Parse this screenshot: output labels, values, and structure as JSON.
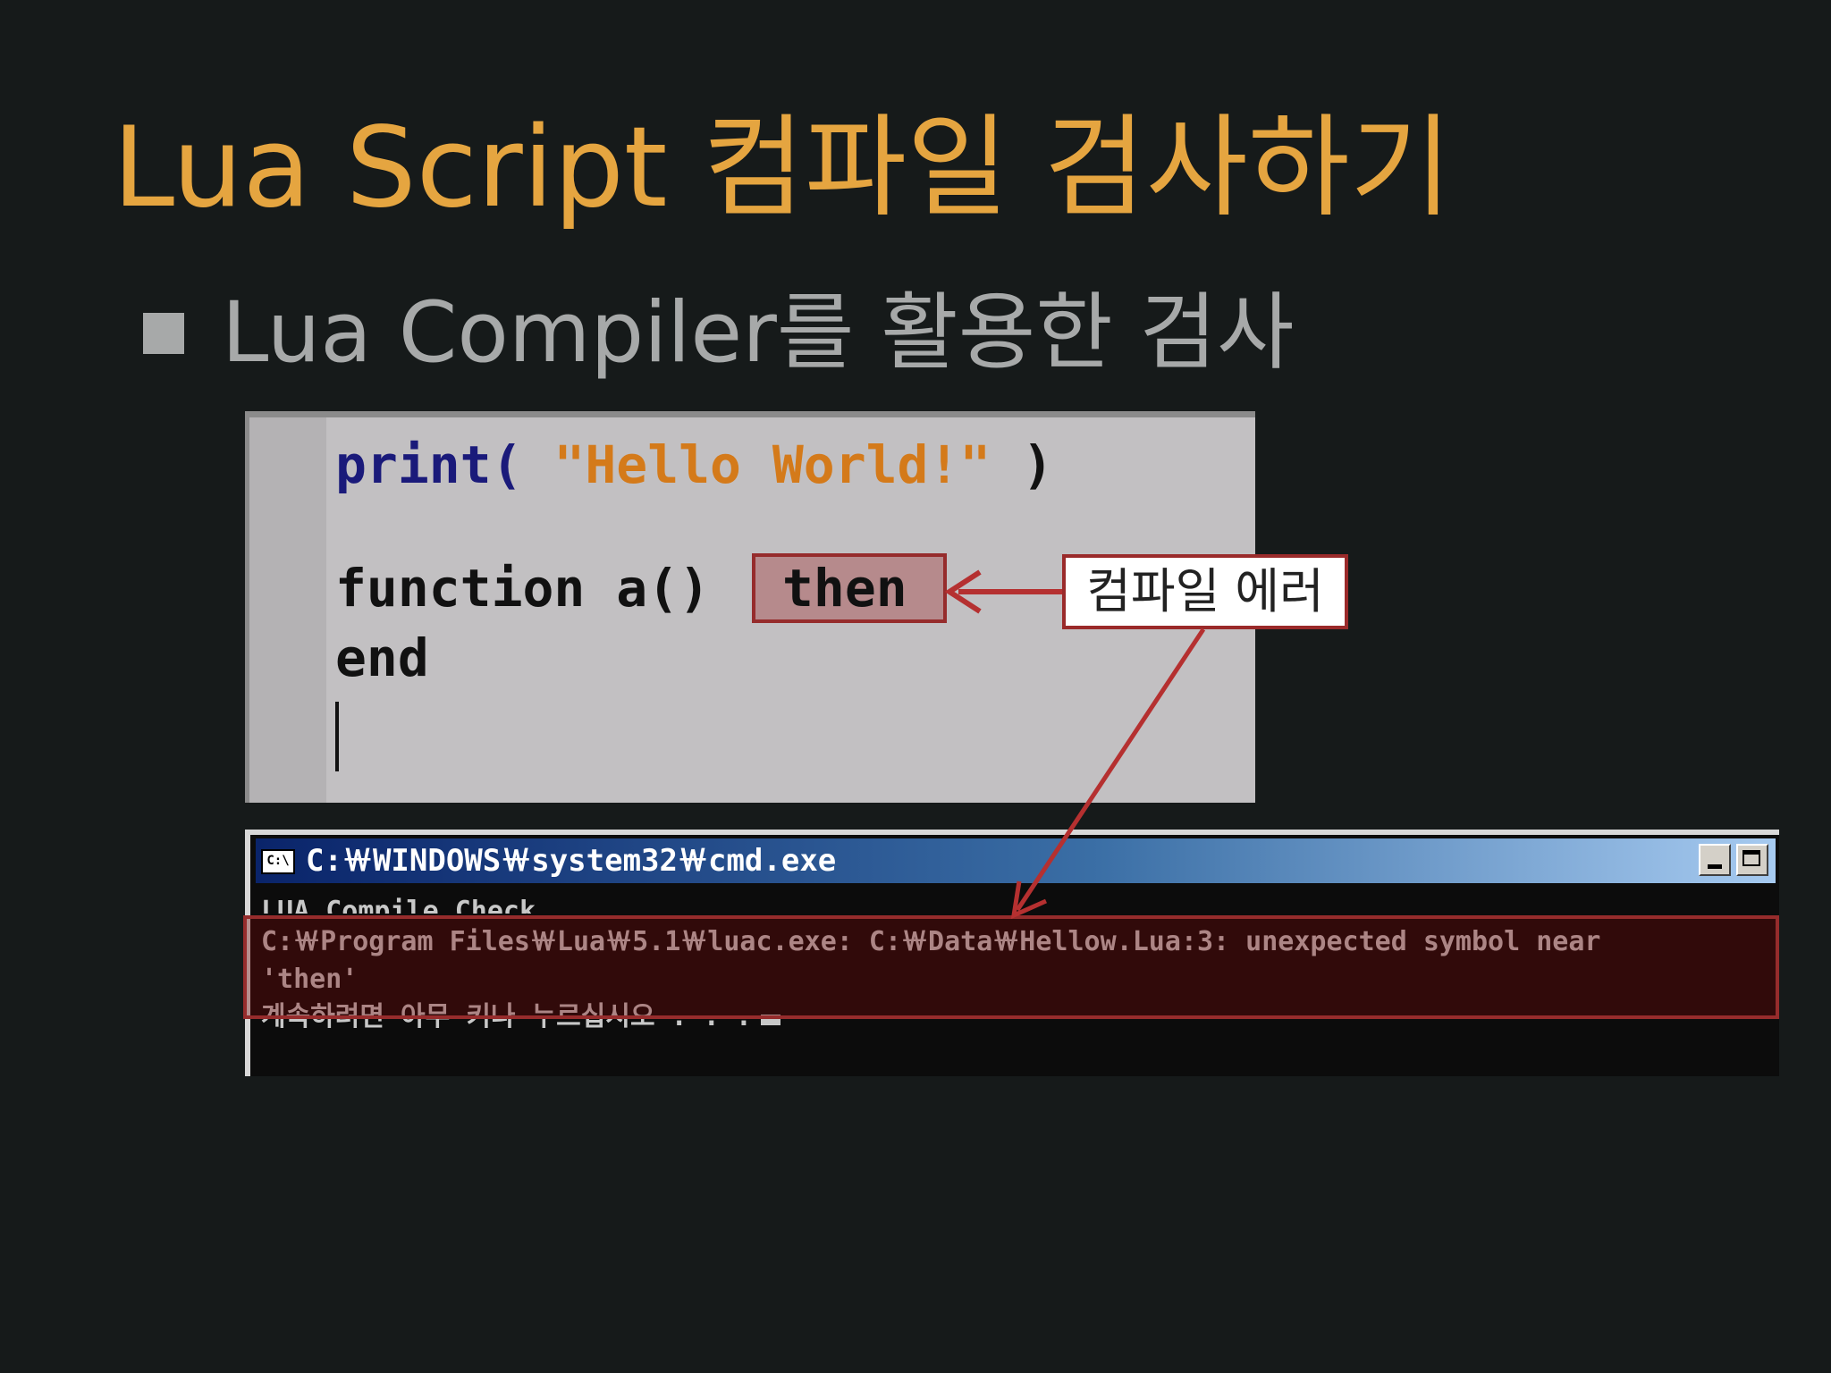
{
  "slide": {
    "title": "Lua Script 컴파일 검사하기",
    "bullet": "Lua Compiler를 활용한 검사"
  },
  "editor": {
    "line1_fn": "print(",
    "line1_str": " \"Hello World!\"",
    "line1_end": " )",
    "line3": "function a()",
    "highlight": "then",
    "line4": "end"
  },
  "callout": {
    "label": "컴파일 에러"
  },
  "console": {
    "window_title": "C:￦WINDOWS￦system32￦cmd.exe",
    "icon_label": "C:\\",
    "lines": [
      "LUA_Compile Check...",
      "C:￦Program Files￦Lua￦5.1￦luac.exe: C:￦Data￦Hellow.Lua:3: unexpected symbol near",
      "'then'",
      "계속하려면 아무 키나 누르십시오 . . ."
    ]
  },
  "colors": {
    "background": "#161a1a",
    "title": "#e5a540",
    "bullet": "#a7a9a9",
    "highlight_border": "#962c2c",
    "arrow": "#b53030"
  },
  "icons": {
    "bullet": "square-bullet-icon",
    "arrow_to_then": "arrow-left-icon",
    "arrow_to_console": "arrow-down-left-icon",
    "console_app": "cmd-icon",
    "minimize": "minimize-icon",
    "maximize": "maximize-icon"
  }
}
